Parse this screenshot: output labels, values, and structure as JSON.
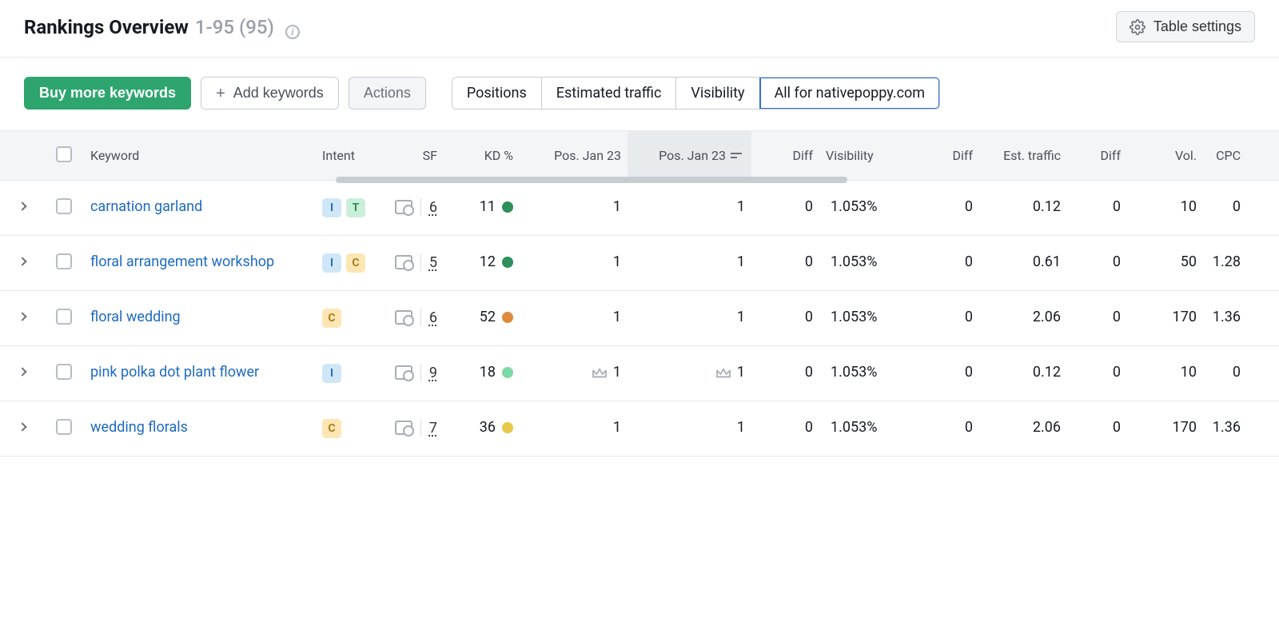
{
  "header": {
    "title": "Rankings Overview",
    "range": "1-95 (95)"
  },
  "toolbar": {
    "buy_label": "Buy more keywords",
    "add_label": "Add keywords",
    "actions_label": "Actions"
  },
  "tabs": {
    "items": [
      "Positions",
      "Estimated traffic",
      "Visibility",
      "All for nativepoppy.com"
    ],
    "active_index": 3
  },
  "table_settings_label": "Table settings",
  "columns": {
    "keyword": "Keyword",
    "intent": "Intent",
    "sf": "SF",
    "kd": "KD %",
    "pos1": "Pos. Jan 23",
    "pos2": "Pos. Jan 23",
    "diff1": "Diff",
    "visibility": "Visibility",
    "diff2": "Diff",
    "est_traffic": "Est. traffic",
    "diff3": "Diff",
    "vol": "Vol.",
    "cpc": "CPC"
  },
  "rows": [
    {
      "keyword": "carnation garland",
      "intent": [
        "I",
        "T"
      ],
      "sf": 6,
      "kd": 11,
      "kd_color": "#2e8f5b",
      "pos1": "1",
      "pos1_crown": false,
      "pos2": "1",
      "pos2_crown": false,
      "diff1": 0,
      "visibility": "1.053%",
      "diff2": 0,
      "est_traffic": "0.12",
      "diff3": 0,
      "vol": 10,
      "cpc": "0"
    },
    {
      "keyword": "floral arrangement workshop",
      "intent": [
        "I",
        "C"
      ],
      "sf": 5,
      "kd": 12,
      "kd_color": "#2e8f5b",
      "pos1": "1",
      "pos1_crown": false,
      "pos2": "1",
      "pos2_crown": false,
      "diff1": 0,
      "visibility": "1.053%",
      "diff2": 0,
      "est_traffic": "0.61",
      "diff3": 0,
      "vol": 50,
      "cpc": "1.28"
    },
    {
      "keyword": "floral wedding",
      "intent": [
        "C"
      ],
      "sf": 6,
      "kd": 52,
      "kd_color": "#e08a3c",
      "pos1": "1",
      "pos1_crown": false,
      "pos2": "1",
      "pos2_crown": false,
      "diff1": 0,
      "visibility": "1.053%",
      "diff2": 0,
      "est_traffic": "2.06",
      "diff3": 0,
      "vol": 170,
      "cpc": "1.36"
    },
    {
      "keyword": "pink polka dot plant flower",
      "intent": [
        "I"
      ],
      "sf": 9,
      "kd": 18,
      "kd_color": "#7fd9a6",
      "pos1": "1",
      "pos1_crown": true,
      "pos2": "1",
      "pos2_crown": true,
      "diff1": 0,
      "visibility": "1.053%",
      "diff2": 0,
      "est_traffic": "0.12",
      "diff3": 0,
      "vol": 10,
      "cpc": "0"
    },
    {
      "keyword": "wedding florals",
      "intent": [
        "C"
      ],
      "sf": 7,
      "kd": 36,
      "kd_color": "#e8c84a",
      "pos1": "1",
      "pos1_crown": false,
      "pos2": "1",
      "pos2_crown": false,
      "diff1": 0,
      "visibility": "1.053%",
      "diff2": 0,
      "est_traffic": "2.06",
      "diff3": 0,
      "vol": 170,
      "cpc": "1.36"
    }
  ]
}
